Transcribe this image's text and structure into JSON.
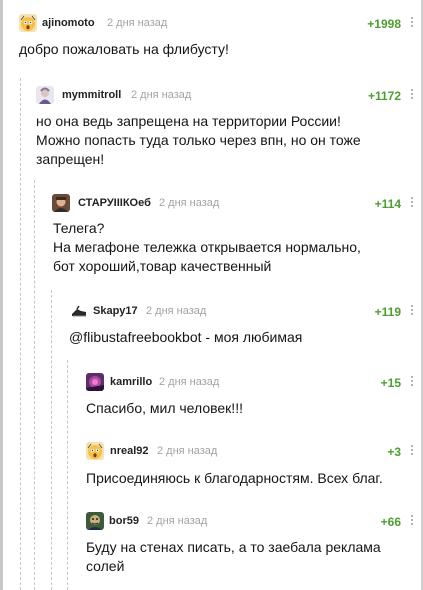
{
  "comments": [
    {
      "username": "ajinomoto",
      "time": "2 дня назад",
      "rating": "+1998",
      "text": "добро пожаловать на флибусту!",
      "avatar_icon": "shocked-face-avatar-icon"
    },
    {
      "username": "mymmitroll",
      "time": "2 дня назад",
      "rating": "+1172",
      "text": "но она ведь запрещена на территории России!\nМожно попасть туда только через впн, но он тоже запрещен!",
      "avatar_icon": "character-avatar-icon"
    },
    {
      "username": "СТАРУIIIКОеб",
      "time": "2 дня назад",
      "rating": "+114",
      "text": "Телега?\nНа мегафоне тележка открывается нормально,\nбот хороший,товар качественный",
      "avatar_icon": "portrait-avatar-icon"
    },
    {
      "username": "Skapy17",
      "time": "2 дня назад",
      "rating": "+119",
      "text": "@flibustafreebookbot - моя любимая",
      "avatar_icon": "dark-sneaker-avatar-icon"
    },
    {
      "username": "kamrillo",
      "time": "2 дня назад",
      "rating": "+15",
      "text": "Спасибо, мил человек!!!",
      "avatar_icon": "purple-avatar-icon"
    },
    {
      "username": "nreal92",
      "time": "2 дня назад",
      "rating": "+3",
      "text": "Присоединяюсь к благодарностям. Всех благ.",
      "avatar_icon": "shocked-face-avatar-icon"
    },
    {
      "username": "bor59",
      "time": "2 дня назад",
      "rating": "+66",
      "text": "Буду на стенах писать, а то заебала реклама солей",
      "avatar_icon": "cartoon-avatar-icon"
    }
  ],
  "colors": {
    "rating": "#4c9e2f",
    "time": "#a3a3a3",
    "thread_line": "#c8c8c8"
  }
}
